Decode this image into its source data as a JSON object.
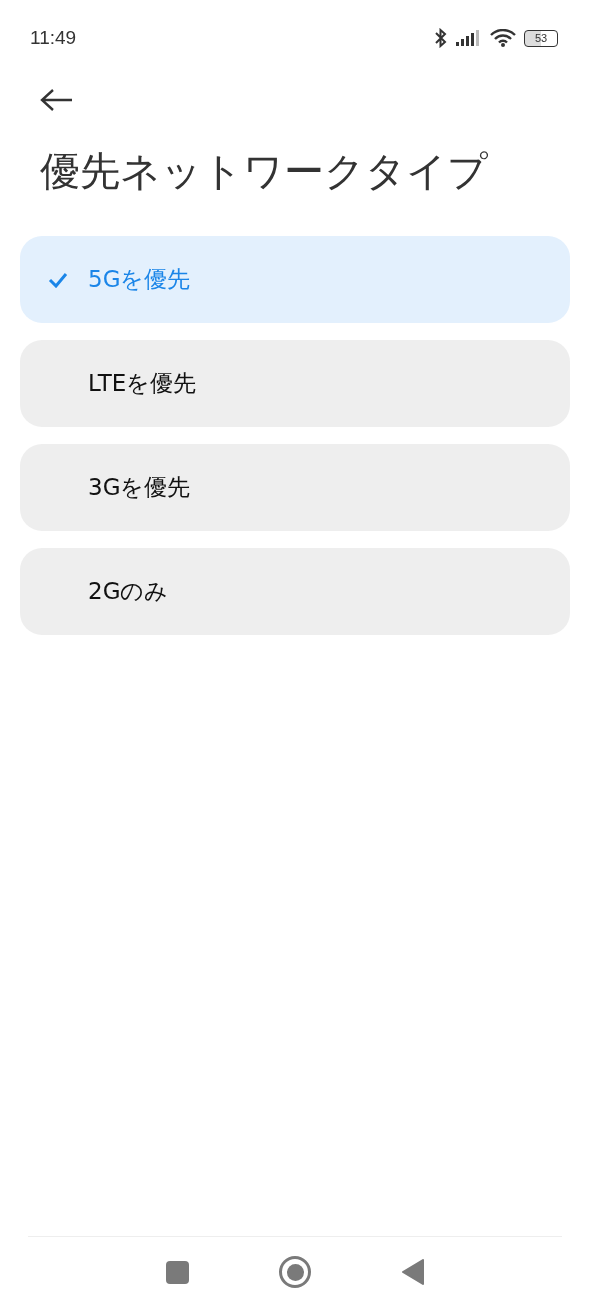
{
  "status_bar": {
    "time": "11:49",
    "battery": "53"
  },
  "title": "優先ネットワークタイプ",
  "options": [
    {
      "label": "5Gを優先",
      "selected": true
    },
    {
      "label": "LTEを優先",
      "selected": false
    },
    {
      "label": "3Gを優先",
      "selected": false
    },
    {
      "label": "2Gのみ",
      "selected": false
    }
  ]
}
